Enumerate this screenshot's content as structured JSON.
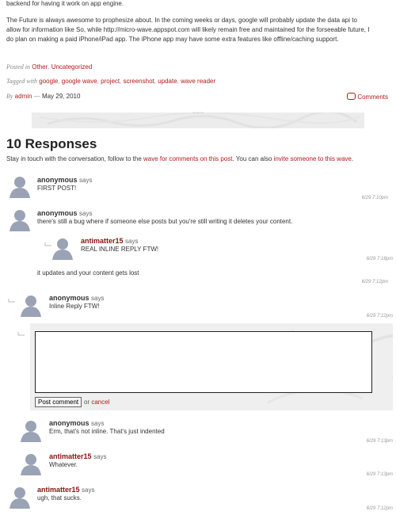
{
  "post": {
    "top_line": "backend for having it work on app engine.",
    "paragraph": "The Future is always awesome to prophesize about. In the coming weeks or days, google will probably update the data api to allow for information like So, while http://micro-wave.appspot.com will likely remain free and maintained for the forseeable future, I do plan on making a paid iPhone/iPad app. The iPhone app may have some extra features like offline/caching support.",
    "posted_in_label": "Posted in",
    "categories": [
      "Other",
      "Uncategorized"
    ],
    "tagged_label": "Tagged with",
    "tags": [
      "google",
      "google wave",
      "project",
      "screenshot",
      "update",
      "wave reader"
    ],
    "by_label": "By",
    "author": "admin",
    "date_sep": "—",
    "date": "May 29, 2010",
    "comments_link": "Comments"
  },
  "responses": {
    "title": "10 Responses",
    "stay_prefix": "Stay in touch with the conversation, follow to the",
    "wave_link": "wave for comments on this post",
    "stay_middle": ". You can also",
    "invite_link": "invite someone to this wave",
    "stay_suffix": "."
  },
  "says_label": "says",
  "comments": [
    {
      "author": "anonymous",
      "text": "FIRST POST!",
      "time": "6/29 7:10pm"
    },
    {
      "author": "anonymous",
      "text": "there's still a bug where if someone else posts but you're still writing it deletes your content.",
      "time": ""
    },
    {
      "author": "antimatter15",
      "text": "REAL INLINE REPLY FTW!",
      "time": "6/29 7:18pm"
    },
    {
      "author": "",
      "text": "it updates and your content gets lost",
      "time": "6/29 7:12pm"
    },
    {
      "author": "anonymous",
      "text": "Inline Reply FTW!",
      "time": "6/29 7:12pm"
    },
    {
      "author": "anonymous",
      "text": "Erm, that's not inline. That's just indented",
      "time": "6/29 7:13pm"
    },
    {
      "author": "antimatter15",
      "text": "Whatever.",
      "time": "6/29 7:13pm"
    },
    {
      "author": "antimatter15",
      "text": "ugh, that sucks.",
      "time": "6/29 7:12pm"
    }
  ],
  "reply_form": {
    "textarea_value": "",
    "submit_label": "Post comment",
    "or_label": "or",
    "cancel_label": "cancel"
  },
  "colors": {
    "link": "#b11a1a",
    "author_red": "#8a1010",
    "avatar": "#9aa3b5"
  },
  "icons": {
    "avatar": "user-silhouette-icon",
    "reply": "reply-arrow-icon",
    "comments": "speech-bubble-icon"
  }
}
